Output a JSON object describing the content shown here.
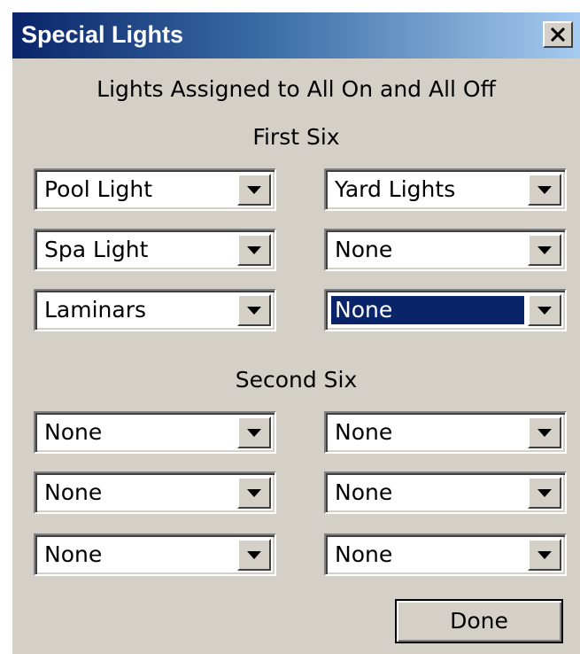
{
  "window": {
    "title": "Special Lights"
  },
  "header": {
    "description": "Lights Assigned to All On and All Off",
    "first_group_label": "First Six",
    "second_group_label": "Second Six"
  },
  "first_six": {
    "left": [
      "Pool Light",
      "Spa Light",
      "Laminars"
    ],
    "right": [
      "Yard Lights",
      "None",
      "None"
    ]
  },
  "second_six": {
    "left": [
      "None",
      "None",
      "None"
    ],
    "right": [
      "None",
      "None",
      "None"
    ]
  },
  "selected_dropdown": "first_six.right.2",
  "buttons": {
    "done": "Done"
  },
  "icons": {
    "close": "close-icon",
    "dropdown": "chevron-down-icon"
  },
  "colors": {
    "title_start": "#0a246a",
    "title_end": "#a6caf0",
    "face": "#d4d0c8",
    "selection": "#0a246a"
  }
}
